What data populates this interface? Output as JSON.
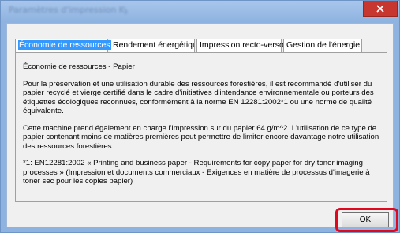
{
  "window": {
    "title": "Paramètres d'impression Kyocera",
    "close_icon": "close-icon"
  },
  "tabs": [
    {
      "label": "Économie de ressources",
      "active": true
    },
    {
      "label": "Rendement énergétique",
      "active": false
    },
    {
      "label": "Impression recto-verso",
      "active": false
    },
    {
      "label": "Gestion de l'énergie",
      "active": false
    }
  ],
  "content": {
    "heading": "Économie de ressources - Papier",
    "para1": "Pour la préservation et une utilisation durable des ressources forestières, il est recommandé d'utiliser du papier recyclé et vierge certifié dans le cadre d'initiatives d'intendance environnementale ou porteurs des étiquettes écologiques reconnues, conformément à la norme EN 12281:2002*1 ou une norme de qualité équivalente.",
    "para2": "Cette machine prend également en charge l'impression sur du papier 64 g/m^2.  L'utilisation de ce type de papier contenant moins de matières premières peut permettre de limiter encore davantage notre utilisation des ressources forestières.",
    "footnote": "*1: EN12281:2002 « Printing and business paper - Requirements for copy paper for dry toner imaging processes » (Impression et documents commerciaux - Exigences en matière de processus d'imagerie à toner sec pour les copies papier)"
  },
  "buttons": {
    "ok_label": "OK"
  },
  "colors": {
    "tab_selection": "#3399ff",
    "close_button": "#c7372f",
    "highlight_box": "#e0081e",
    "title_bar": "#8fb3e0"
  }
}
